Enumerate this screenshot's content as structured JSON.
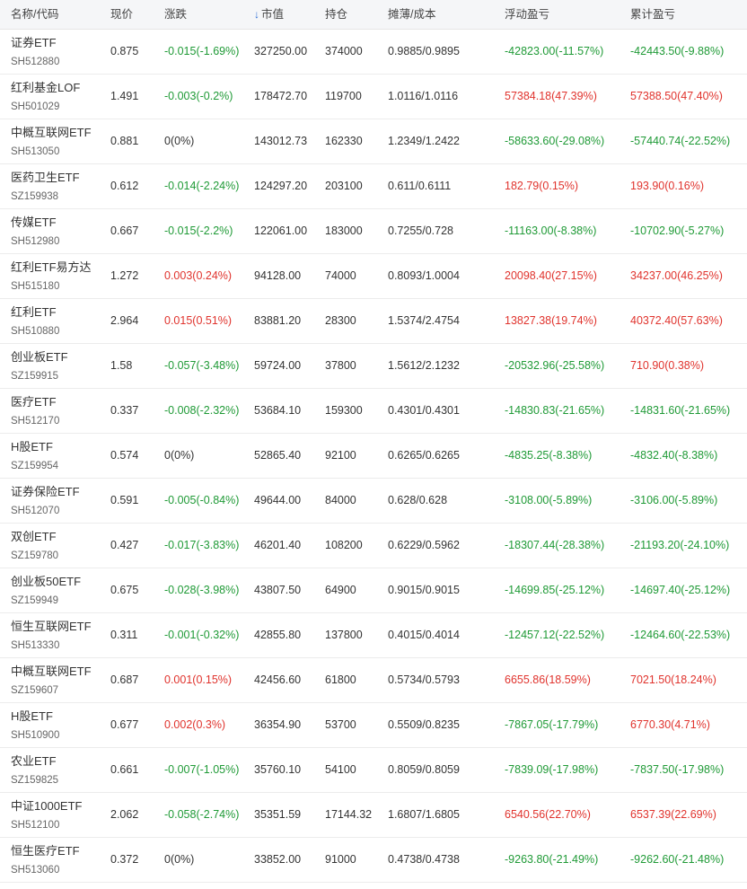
{
  "header": {
    "name_code": "名称/代码",
    "price": "现价",
    "change": "涨跌",
    "market_value": "市值",
    "market_value_sort_icon": "arrow-down-icon",
    "position": "持仓",
    "cost": "摊薄/成本",
    "floating_pnl": "浮动盈亏",
    "accumulated_pnl": "累计盈亏"
  },
  "colors": {
    "up": "#e0332d",
    "down": "#1f9a36",
    "flat": "#333333",
    "sort": "#2f6fd6"
  },
  "rows": [
    {
      "name": "证券ETF",
      "code": "SH512880",
      "price": "0.875",
      "change": "-0.015(-1.69%)",
      "change_dir": "down",
      "market_value": "327250.00",
      "position": "374000",
      "cost": "0.9885/0.9895",
      "floating": "-42823.00(-11.57%)",
      "floating_dir": "down",
      "accumulated": "-42443.50(-9.88%)",
      "accumulated_dir": "down"
    },
    {
      "name": "红利基金LOF",
      "code": "SH501029",
      "price": "1.491",
      "change": "-0.003(-0.2%)",
      "change_dir": "down",
      "market_value": "178472.70",
      "position": "119700",
      "cost": "1.0116/1.0116",
      "floating": "57384.18(47.39%)",
      "floating_dir": "up",
      "accumulated": "57388.50(47.40%)",
      "accumulated_dir": "up"
    },
    {
      "name": "中概互联网ETF",
      "code": "SH513050",
      "price": "0.881",
      "change": "0(0%)",
      "change_dir": "flat",
      "market_value": "143012.73",
      "position": "162330",
      "cost": "1.2349/1.2422",
      "floating": "-58633.60(-29.08%)",
      "floating_dir": "down",
      "accumulated": "-57440.74(-22.52%)",
      "accumulated_dir": "down"
    },
    {
      "name": "医药卫生ETF",
      "code": "SZ159938",
      "price": "0.612",
      "change": "-0.014(-2.24%)",
      "change_dir": "down",
      "market_value": "124297.20",
      "position": "203100",
      "cost": "0.611/0.6111",
      "floating": "182.79(0.15%)",
      "floating_dir": "up",
      "accumulated": "193.90(0.16%)",
      "accumulated_dir": "up"
    },
    {
      "name": "传媒ETF",
      "code": "SH512980",
      "price": "0.667",
      "change": "-0.015(-2.2%)",
      "change_dir": "down",
      "market_value": "122061.00",
      "position": "183000",
      "cost": "0.7255/0.728",
      "floating": "-11163.00(-8.38%)",
      "floating_dir": "down",
      "accumulated": "-10702.90(-5.27%)",
      "accumulated_dir": "down"
    },
    {
      "name": "红利ETF易方达",
      "code": "SH515180",
      "price": "1.272",
      "change": "0.003(0.24%)",
      "change_dir": "up",
      "market_value": "94128.00",
      "position": "74000",
      "cost": "0.8093/1.0004",
      "floating": "20098.40(27.15%)",
      "floating_dir": "up",
      "accumulated": "34237.00(46.25%)",
      "accumulated_dir": "up"
    },
    {
      "name": "红利ETF",
      "code": "SH510880",
      "price": "2.964",
      "change": "0.015(0.51%)",
      "change_dir": "up",
      "market_value": "83881.20",
      "position": "28300",
      "cost": "1.5374/2.4754",
      "floating": "13827.38(19.74%)",
      "floating_dir": "up",
      "accumulated": "40372.40(57.63%)",
      "accumulated_dir": "up"
    },
    {
      "name": "创业板ETF",
      "code": "SZ159915",
      "price": "1.58",
      "change": "-0.057(-3.48%)",
      "change_dir": "down",
      "market_value": "59724.00",
      "position": "37800",
      "cost": "1.5612/2.1232",
      "floating": "-20532.96(-25.58%)",
      "floating_dir": "down",
      "accumulated": "710.90(0.38%)",
      "accumulated_dir": "up"
    },
    {
      "name": "医疗ETF",
      "code": "SH512170",
      "price": "0.337",
      "change": "-0.008(-2.32%)",
      "change_dir": "down",
      "market_value": "53684.10",
      "position": "159300",
      "cost": "0.4301/0.4301",
      "floating": "-14830.83(-21.65%)",
      "floating_dir": "down",
      "accumulated": "-14831.60(-21.65%)",
      "accumulated_dir": "down"
    },
    {
      "name": "H股ETF",
      "code": "SZ159954",
      "price": "0.574",
      "change": "0(0%)",
      "change_dir": "flat",
      "market_value": "52865.40",
      "position": "92100",
      "cost": "0.6265/0.6265",
      "floating": "-4835.25(-8.38%)",
      "floating_dir": "down",
      "accumulated": "-4832.40(-8.38%)",
      "accumulated_dir": "down"
    },
    {
      "name": "证券保险ETF",
      "code": "SH512070",
      "price": "0.591",
      "change": "-0.005(-0.84%)",
      "change_dir": "down",
      "market_value": "49644.00",
      "position": "84000",
      "cost": "0.628/0.628",
      "floating": "-3108.00(-5.89%)",
      "floating_dir": "down",
      "accumulated": "-3106.00(-5.89%)",
      "accumulated_dir": "down"
    },
    {
      "name": "双创ETF",
      "code": "SZ159780",
      "price": "0.427",
      "change": "-0.017(-3.83%)",
      "change_dir": "down",
      "market_value": "46201.40",
      "position": "108200",
      "cost": "0.6229/0.5962",
      "floating": "-18307.44(-28.38%)",
      "floating_dir": "down",
      "accumulated": "-21193.20(-24.10%)",
      "accumulated_dir": "down"
    },
    {
      "name": "创业板50ETF",
      "code": "SZ159949",
      "price": "0.675",
      "change": "-0.028(-3.98%)",
      "change_dir": "down",
      "market_value": "43807.50",
      "position": "64900",
      "cost": "0.9015/0.9015",
      "floating": "-14699.85(-25.12%)",
      "floating_dir": "down",
      "accumulated": "-14697.40(-25.12%)",
      "accumulated_dir": "down"
    },
    {
      "name": "恒生互联网ETF",
      "code": "SH513330",
      "price": "0.311",
      "change": "-0.001(-0.32%)",
      "change_dir": "down",
      "market_value": "42855.80",
      "position": "137800",
      "cost": "0.4015/0.4014",
      "floating": "-12457.12(-22.52%)",
      "floating_dir": "down",
      "accumulated": "-12464.60(-22.53%)",
      "accumulated_dir": "down"
    },
    {
      "name": "中概互联网ETF",
      "code": "SZ159607",
      "price": "0.687",
      "change": "0.001(0.15%)",
      "change_dir": "up",
      "market_value": "42456.60",
      "position": "61800",
      "cost": "0.5734/0.5793",
      "floating": "6655.86(18.59%)",
      "floating_dir": "up",
      "accumulated": "7021.50(18.24%)",
      "accumulated_dir": "up"
    },
    {
      "name": "H股ETF",
      "code": "SH510900",
      "price": "0.677",
      "change": "0.002(0.3%)",
      "change_dir": "up",
      "market_value": "36354.90",
      "position": "53700",
      "cost": "0.5509/0.8235",
      "floating": "-7867.05(-17.79%)",
      "floating_dir": "down",
      "accumulated": "6770.30(4.71%)",
      "accumulated_dir": "up"
    },
    {
      "name": "农业ETF",
      "code": "SZ159825",
      "price": "0.661",
      "change": "-0.007(-1.05%)",
      "change_dir": "down",
      "market_value": "35760.10",
      "position": "54100",
      "cost": "0.8059/0.8059",
      "floating": "-7839.09(-17.98%)",
      "floating_dir": "down",
      "accumulated": "-7837.50(-17.98%)",
      "accumulated_dir": "down"
    },
    {
      "name": "中证1000ETF",
      "code": "SH512100",
      "price": "2.062",
      "change": "-0.058(-2.74%)",
      "change_dir": "down",
      "market_value": "35351.59",
      "position": "17144.32",
      "cost": "1.6807/1.6805",
      "floating": "6540.56(22.70%)",
      "floating_dir": "up",
      "accumulated": "6537.39(22.69%)",
      "accumulated_dir": "up"
    },
    {
      "name": "恒生医疗ETF",
      "code": "SH513060",
      "price": "0.372",
      "change": "0(0%)",
      "change_dir": "flat",
      "market_value": "33852.00",
      "position": "91000",
      "cost": "0.4738/0.4738",
      "floating": "-9263.80(-21.49%)",
      "floating_dir": "down",
      "accumulated": "-9262.60(-21.48%)",
      "accumulated_dir": "down"
    }
  ]
}
